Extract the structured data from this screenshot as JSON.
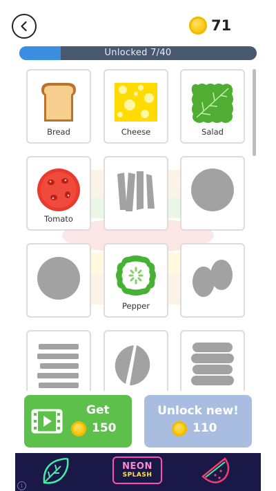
{
  "header": {
    "coins": "71"
  },
  "progress": {
    "label": "Unlocked 7/40",
    "unlocked": 7,
    "total": 40
  },
  "items": [
    {
      "label": "Bread",
      "icon": "bread-icon",
      "unlocked": true
    },
    {
      "label": "Cheese",
      "icon": "cheese-icon",
      "unlocked": true
    },
    {
      "label": "Salad",
      "icon": "salad-icon",
      "unlocked": true
    },
    {
      "label": "Tomato",
      "icon": "tomato-icon",
      "unlocked": true
    },
    {
      "label": "",
      "icon": "locked-slices-icon",
      "unlocked": false
    },
    {
      "label": "",
      "icon": "locked-circle-icon",
      "unlocked": false
    },
    {
      "label": "",
      "icon": "locked-circle-icon",
      "unlocked": false
    },
    {
      "label": "Pepper",
      "icon": "pepper-icon",
      "unlocked": true
    },
    {
      "label": "",
      "icon": "locked-ovals-icon",
      "unlocked": false
    },
    {
      "label": "",
      "icon": "locked-strips-icon",
      "unlocked": false
    },
    {
      "label": "",
      "icon": "locked-split-circle-icon",
      "unlocked": false
    },
    {
      "label": "",
      "icon": "locked-stack-icon",
      "unlocked": false
    }
  ],
  "buttons": {
    "get": {
      "title": "Get",
      "price": "150"
    },
    "unlock": {
      "title": "Unlock new!",
      "price": "110"
    }
  },
  "ad": {
    "logo_top": "NEON",
    "logo_bottom": "SPLASH",
    "info": "i"
  },
  "colors": {
    "progress_bg": "#47586f",
    "progress_fill": "#3b8fe0",
    "get_button": "#5cc04a",
    "unlock_button": "#a9bde0",
    "ad_bg": "#1a1847"
  }
}
